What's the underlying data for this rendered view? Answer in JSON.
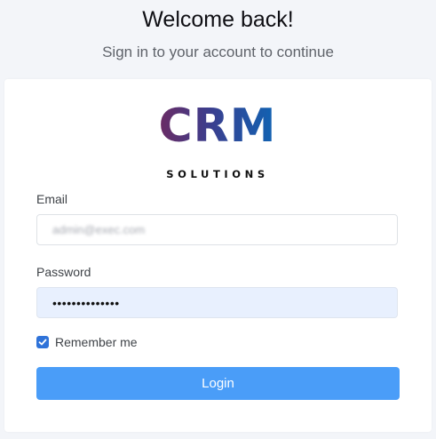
{
  "header": {
    "title": "Welcome back!",
    "subtitle": "Sign in to your account to continue"
  },
  "logo": {
    "main": "CRM",
    "sub": "SOLUTIONS"
  },
  "form": {
    "email": {
      "label": "Email",
      "value": "admin@exec.com"
    },
    "password": {
      "label": "Password",
      "value": "••••••••••••••"
    },
    "remember": {
      "label": "Remember me",
      "checked": true
    },
    "login_label": "Login"
  },
  "colors": {
    "primary": "#4a9df8",
    "checkbox": "#2f73d9",
    "password_bg": "#e8f0fe"
  }
}
